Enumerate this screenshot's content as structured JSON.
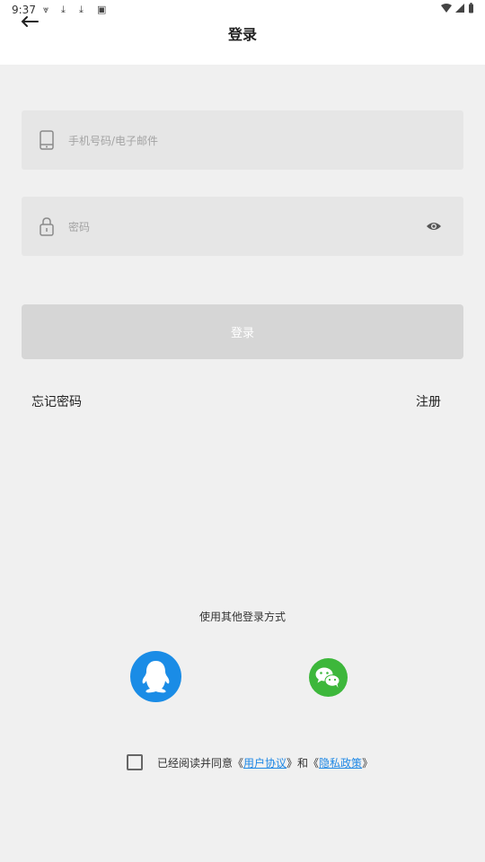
{
  "status_bar": {
    "time": "9:37"
  },
  "header": {
    "title": "登录"
  },
  "form": {
    "account_placeholder": "手机号码/电子邮件",
    "password_placeholder": "密码",
    "login_label": "登录"
  },
  "links": {
    "forgot": "忘记密码",
    "register": "注册"
  },
  "other_login": {
    "label": "使用其他登录方式"
  },
  "agreement": {
    "prefix": "已经阅读并同意《",
    "user_agreement": "用户协议",
    "middle": "》和《",
    "privacy_policy": "隐私政策",
    "suffix": "》"
  },
  "colors": {
    "background": "#f0f0f0",
    "field_bg": "#e6e6e6",
    "button_disabled": "#d6d6d6",
    "link_blue": "#1e88e5",
    "qq_blue": "#1a8ce6",
    "wechat_green": "#3db73b"
  },
  "icons": {
    "back": "back-arrow-icon",
    "phone": "phone-icon",
    "lock": "lock-icon",
    "eye": "eye-icon",
    "qq": "qq-icon",
    "wechat": "wechat-icon"
  }
}
